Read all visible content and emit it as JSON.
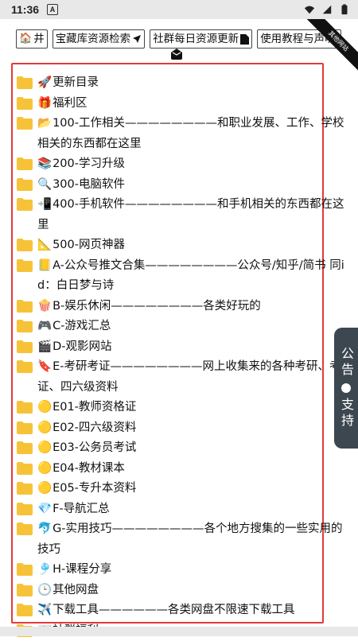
{
  "status_bar": {
    "time": "11:36",
    "notif_glyph": "A"
  },
  "toolbar": {
    "home_label": "井",
    "search_label": "宝藏库资源检索",
    "update_label": "社群每日资源更新",
    "usage_label": "使用教程与声明"
  },
  "ribbon": {
    "label": "其他网站"
  },
  "side_tab": {
    "label_top": "公告",
    "label_bottom": "支持"
  },
  "items": [
    {
      "emoji": "🚀",
      "text": "更新目录"
    },
    {
      "emoji": "🎁",
      "text": "福利区"
    },
    {
      "emoji": "📂",
      "text": "100-工作相关————————和职业发展、工作、学校相关的东西都在这里"
    },
    {
      "emoji": "📚",
      "text": "200-学习升级"
    },
    {
      "emoji": "🔍",
      "text": "300-电脑软件"
    },
    {
      "emoji": "📲",
      "text": "400-手机软件————————和手机相关的东西都在这里"
    },
    {
      "emoji": "📐",
      "text": "500-网页神器"
    },
    {
      "emoji": "📒",
      "text": "A-公众号推文合集————————公众号/知乎/简书 同id：白日梦与诗"
    },
    {
      "emoji": "🍿",
      "text": "B-娱乐休闲————————各类好玩的"
    },
    {
      "emoji": "🎮",
      "text": "C-游戏汇总"
    },
    {
      "emoji": "🎬",
      "text": "D-观影网站"
    },
    {
      "emoji": "🔖",
      "text": "E-考研考证————————网上收集来的各种考研、考证、四六级资料"
    },
    {
      "emoji": "🟡",
      "text": "E01-教师资格证"
    },
    {
      "emoji": "🟡",
      "text": "E02-四六级资料"
    },
    {
      "emoji": "🟡",
      "text": "E03-公务员考试"
    },
    {
      "emoji": "🟡",
      "text": "E04-教材课本"
    },
    {
      "emoji": "🟡",
      "text": "E05-专升本资料"
    },
    {
      "emoji": "💎",
      "text": "F-导航汇总"
    },
    {
      "emoji": "🐬",
      "text": "G-实用技巧————————各个地方搜集的一些实用的技巧"
    },
    {
      "emoji": "🎐",
      "text": "H-课程分享"
    },
    {
      "emoji": "🕒",
      "text": "其他网盘"
    },
    {
      "emoji": "✈️",
      "text": "下载工具——————各类网盘不限速下载工具"
    },
    {
      "emoji": "📰",
      "text": "社群福利"
    }
  ],
  "colors": {
    "folder": "#f6c338",
    "frame": "#e23a3a",
    "side_tab": "#3c4750"
  }
}
